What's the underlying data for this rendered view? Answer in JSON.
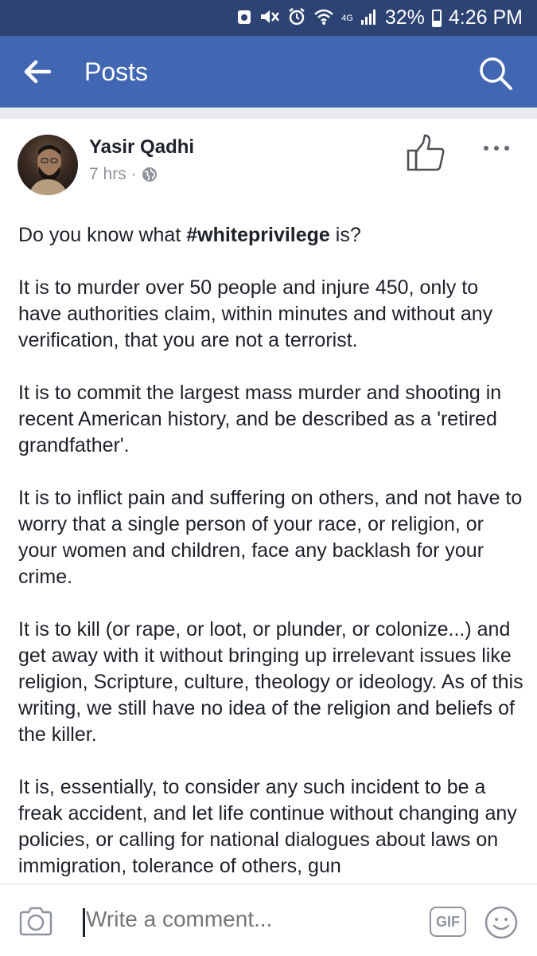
{
  "status_bar": {
    "network": "4G",
    "battery_percent": "32%",
    "battery_level": 0.32,
    "time": "4:26 PM"
  },
  "app_bar": {
    "title": "Posts",
    "back_icon": "arrow-left-icon",
    "search_icon": "search-icon"
  },
  "post": {
    "author": "Yasir Qadhi",
    "time": "7 hrs",
    "separator": "·",
    "privacy_icon": "globe-icon",
    "paragraphs": [
      {
        "before": "Do you know what ",
        "bold": "#whiteprivilege",
        "after": " is?"
      },
      {
        "text": "It is to murder over 50 people and injure 450, only to have authorities claim, within minutes and without any verification, that you are not a terrorist."
      },
      {
        "text": "It is to commit the largest mass murder and shooting in recent American history, and be described as a 'retired grandfather'."
      },
      {
        "text": "It is to inflict pain and suffering on others, and not have to worry that a single person of your race, or religion, or your women and children, face any backlash for your crime."
      },
      {
        "text": "It is to kill (or rape, or loot, or plunder, or colonize...) and get away with it without bringing up irrelevant issues like religion, Scripture, culture, theology or ideology. As of this writing, we still have no idea of the religion and beliefs of the killer."
      },
      {
        "text": "It is, essentially, to consider any such incident to be a freak accident, and let life continue without changing any policies, or calling for national dialogues about laws on immigration,  tolerance of others,  gun"
      }
    ]
  },
  "comment_bar": {
    "placeholder": "Write a comment...",
    "gif_label": "GIF"
  },
  "colors": {
    "status_bar": "#2d4373",
    "app_bar": "#4267b2",
    "text": "#1d2129",
    "muted": "#90949c"
  }
}
